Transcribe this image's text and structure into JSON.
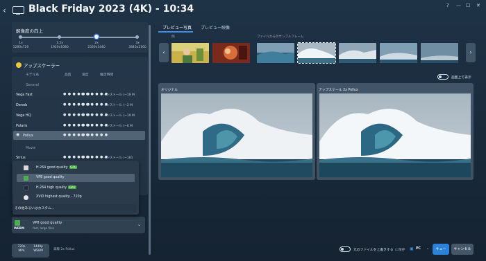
{
  "app": {
    "title": "Black Friday 2023 (4K)   - 10:34"
  },
  "window": {
    "help": "?",
    "minimize": "—",
    "maximize": "☐",
    "close": "✕"
  },
  "resolution": {
    "title": "解像度の向上",
    "options": [
      {
        "mult": "1x",
        "res": "1280x720"
      },
      {
        "mult": "1.5x",
        "res": "1920x1080"
      },
      {
        "mult": "2x",
        "res": "2560x1440"
      },
      {
        "mult": "3x",
        "res": "3840x2160"
      }
    ],
    "selected_index": 2
  },
  "upscaler": {
    "title": "アップスケーラー",
    "columns": {
      "model": "モデル名",
      "quality": "品質",
      "speed": "速度",
      "time": "推定時間"
    },
    "groups": [
      "General",
      "Movie"
    ],
    "models": [
      {
        "name": "Vega Fast",
        "quality": "● ● ● ● ● ●",
        "speed": "● ● ● ● ● ●",
        "install": "インストール (~19 M"
      },
      {
        "name": "Deneb",
        "quality": "● ● ● ● ● ●",
        "speed": "● ● ● ● ● ●",
        "install": "インストール (~2 M"
      },
      {
        "name": "Vega HQ",
        "quality": "● ● ● ● ● ●",
        "speed": "● ● ● ● ● ●",
        "install": "インストール (~19 M"
      },
      {
        "name": "Polaris",
        "quality": "● ● ● ● ● ●",
        "speed": "● ● ● ● ● ●",
        "install": "インストール (~6 M"
      },
      {
        "name": "Pollux",
        "quality": "● ● ● ● ● ●",
        "speed": "● ● ● ● ● ●",
        "install": ""
      },
      {
        "name": "Sirius",
        "quality": "● ● ● ● ● ●",
        "speed": "● ● ● ● ● ●",
        "install": "インストール (~181"
      }
    ],
    "selected": "Pollux"
  },
  "encoder_menu": {
    "options": [
      {
        "label": "H.264 good quality",
        "gpu": "GPU",
        "icon": "hd-icon",
        "color": "#d8d8d8"
      },
      {
        "label": "VP8 good quality",
        "gpu": "",
        "icon": "webm-icon",
        "color": "#4caf50"
      },
      {
        "label": "H.264 high quality",
        "gpu": "GPU",
        "icon": "mp4-icon",
        "color": "#1d2a36"
      },
      {
        "label": "XViD highest quality - 720p",
        "gpu": "",
        "icon": "xvid-icon",
        "color": "#e6e6e6"
      }
    ],
    "selected_index": 1,
    "custom": "その他あるいはカスタム..."
  },
  "encoder": {
    "badge": "WEBM",
    "name": "VP8 good quality",
    "sub": "fast, large files"
  },
  "format": {
    "input_res": "720p",
    "input_fmt": "MP4",
    "output_res": "1440p",
    "output_fmt": "WEBM",
    "info": "高級 2x Pollux"
  },
  "tabs": [
    "プレビュー写真",
    "プレビュー映像"
  ],
  "strip": {
    "examples": "例",
    "samples": "ファイルからのサンプルフレーム"
  },
  "fullscreen": {
    "label": "画面上で表示"
  },
  "panes": {
    "original": "オリジナル",
    "upscaled": "アップスケール 2x Pollux"
  },
  "bottom": {
    "overwrite": "元のファイルを上書きする",
    "save_label": "に保存",
    "save_target": "PC",
    "queue": "キュー",
    "cancel": "キャンセル"
  }
}
